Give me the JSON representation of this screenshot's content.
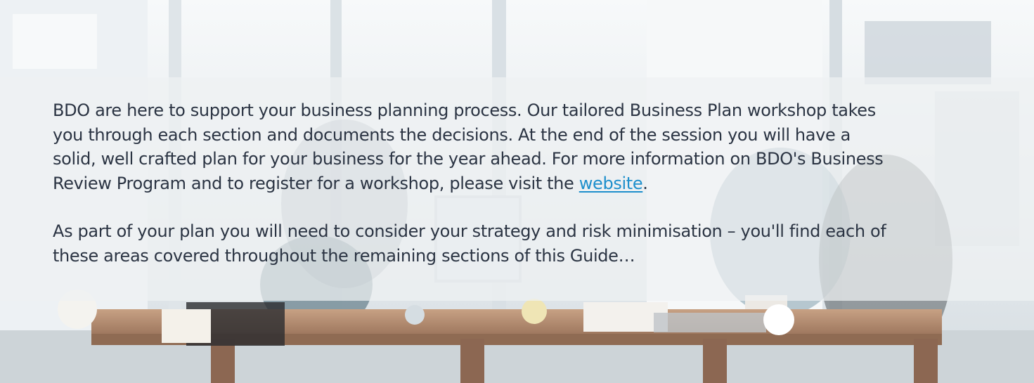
{
  "content": {
    "paragraph1": {
      "line1": "BDO are here to support your business planning process.  Our tailored Business Plan workshop takes",
      "line2": "you through each section and documents the decisions.  At the end of the session you will have a",
      "line3": "solid, well crafted plan for your business for the year ahead.  For more information on BDO's Business",
      "line4_before_link": "Review Program and to register for a workshop, please visit the ",
      "link_text": "website",
      "line4_after_link": "."
    },
    "paragraph2": {
      "line1": "As part of your plan you will need to consider your strategy and risk minimisation – you'll find each of",
      "line2": "these areas covered throughout the remaining sections of this Guide…"
    }
  },
  "colors": {
    "text": "#2b3443",
    "link": "#1d8fcc",
    "overlay": "#eef1f3"
  }
}
